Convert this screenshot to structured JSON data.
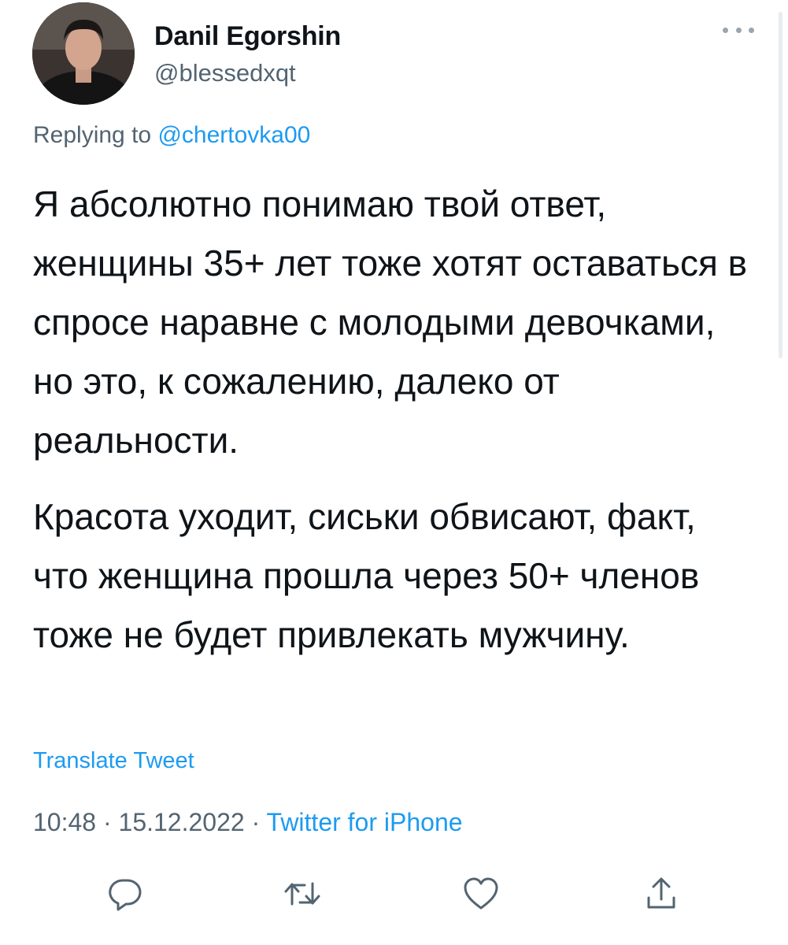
{
  "author": {
    "name": "Danil Egorshin",
    "handle": "@blessedxqt"
  },
  "reply": {
    "prefix": "Replying to ",
    "mention": "@chertovka00"
  },
  "tweet": {
    "paragraphs": [
      "Я абсолютно понимаю твой ответ, женщины 35+ лет тоже хотят оставаться в спросе наравне с молодыми девочками, но это, к сожалению, далеко от реальности.",
      "Красота уходит, сиськи обвисают, факт, что женщина прошла через 50+ членов тоже не будет привлекать мужчину."
    ],
    "translate_label": "Translate Tweet",
    "time": "10:48",
    "separator": " · ",
    "date": "15.12.2022",
    "source": "Twitter for iPhone"
  },
  "actions": {
    "icons": [
      "reply-icon",
      "retweet-icon",
      "like-icon",
      "share-icon"
    ]
  },
  "colors": {
    "accent": "#1d9bf0",
    "text": "#0f1419",
    "secondary": "#536471"
  }
}
